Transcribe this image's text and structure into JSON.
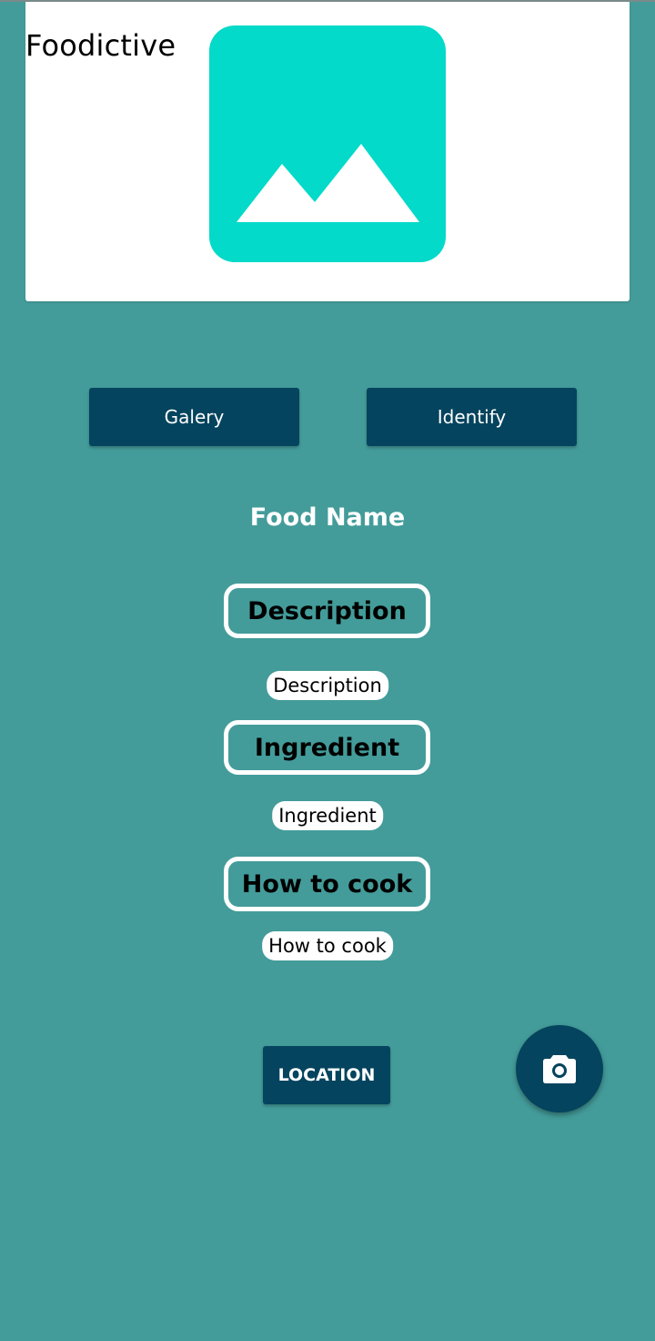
{
  "app": {
    "title": "Foodictive"
  },
  "buttons": {
    "galery": "Galery",
    "identify": "Identify",
    "location": "LOCATION"
  },
  "food": {
    "name": "Food Name"
  },
  "sections": {
    "description_header": "Description",
    "description_value": "Description",
    "ingredient_header": "Ingredient",
    "ingredient_value": "Ingredient",
    "how_to_cook_header": "How to cook",
    "how_to_cook_value": "How to cook"
  },
  "icons": {
    "image_placeholder": "image-placeholder-icon",
    "camera": "camera-icon"
  },
  "colors": {
    "background": "#439c9a",
    "card": "#ffffff",
    "button": "#05445e",
    "placeholder": "#04dac9"
  }
}
